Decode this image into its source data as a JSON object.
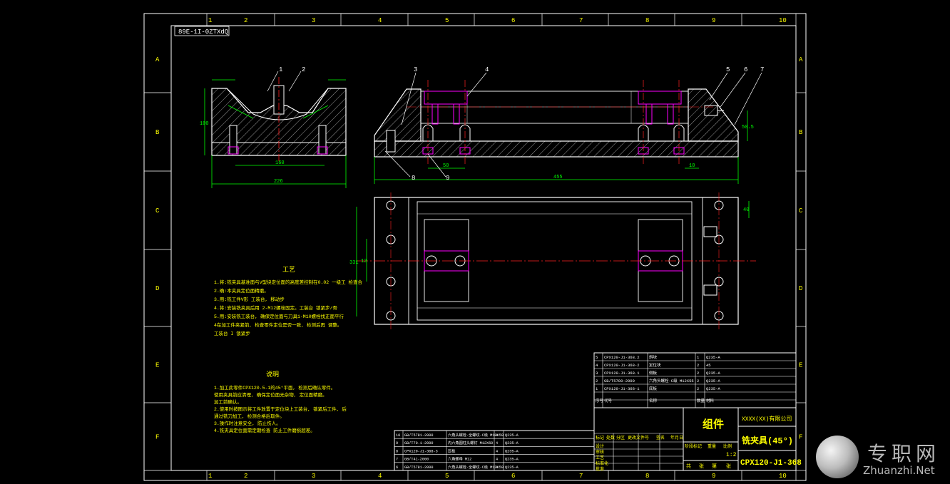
{
  "drawing": {
    "stamp_topleft": "89E-1I-0ZTXdQ",
    "drawing_no": "CPX120-J1-368",
    "title_main": "铣夹具(45°)",
    "title_assembly": "组件",
    "scale": "1:2",
    "company": "XXXX(XX)有限公司"
  },
  "grid": {
    "cols": [
      "1",
      "2",
      "3",
      "4",
      "5",
      "6",
      "7",
      "8",
      "9",
      "10"
    ],
    "rows": [
      "A",
      "B",
      "C",
      "D",
      "E",
      "F"
    ]
  },
  "dims": {
    "front_width": "226",
    "front_inner": "160",
    "front_height": "100",
    "side_length": "455",
    "side_a": "50",
    "side_b": "10",
    "side_h": "50.5",
    "plan_w": "331",
    "plan_a": "12",
    "plan_b": "40"
  },
  "callouts": [
    "1",
    "2",
    "3",
    "4",
    "5",
    "6",
    "7",
    "8",
    "9"
  ],
  "notes": {
    "title1": "工艺",
    "lines1": [
      "1.将:铣夹具基准面与V型块定位面的高度差控制在0.02 一级工 检查合",
      "2.确:本夹具定位面精磨。",
      "3.用:铣工件V形 工装台, 移动步",
      "4.将:安装铣夹具后用 2-M12螺栓固定。工装台 锁紧步/骨",
      "5.用:安装铣工装台, 确保定位面与刀具1-M10螺栓找正面平行",
      "4在加工件夹紧前, 检查零件定位是否一致, 检测后再 调整。",
      "工装台 I 锁紧步"
    ],
    "title2": "说明",
    "lines2": [
      "1.加工此零件CPX120.5-1的45°平面, 检测后确认零件。",
      "使用夹具前应清理, 确保定位面无杂物, 定位面精磨。",
      "加工前确认。",
      "2.使用时按图示将工件放置于定位块上工装台, 锁紧后工件, 后",
      "通过铣刀加工, 检测合格后取件。",
      "3.操作时注意安全, 防止伤人。",
      "4.铣夹具定位面需定期检查 防止工件磨损超差。"
    ]
  },
  "bom_upper": {
    "rows": [
      [
        "5",
        "CPX120-J1-368.2",
        "斜块",
        "1",
        "Q235-A"
      ],
      [
        "4",
        "CPX120-J1-368-2",
        "定位块",
        "2",
        "45"
      ],
      [
        "3",
        "CPX120-J1-368.1",
        "侧板",
        "2",
        "Q235-A"
      ],
      [
        "2",
        "GB/T5780-2000",
        "六角头螺栓-C级 M12X55",
        "2",
        "Q235-A"
      ],
      [
        "1",
        "CPX120-J1-368-1",
        "底板",
        "2",
        "Q235-A"
      ]
    ],
    "header": [
      "序号",
      "代号",
      "名称",
      "数量",
      "材料"
    ]
  },
  "bom_lower": {
    "rows": [
      [
        "10",
        "GB/T5781-2000",
        "六角头螺栓-全螺纹-C级 M10X50",
        "4",
        "Q235-A"
      ],
      [
        "9",
        "GB/T70.1-2000",
        "内六角圆柱头螺钉 M12X60",
        "4",
        "Q235-A"
      ],
      [
        "8",
        "CPX120-J1-368-3",
        "压板",
        "4",
        "Q235-A"
      ],
      [
        "7",
        "GB/T41-2000",
        "六角螺母 M12",
        "4",
        "Q235-A"
      ],
      [
        "6",
        "GB/T5781-2000",
        "六角头螺栓-全螺纹-C级 M12X50",
        "4",
        "Q235-A"
      ]
    ]
  },
  "titleblock": {
    "labels": [
      "标记",
      "处数",
      "分区",
      "更改文件号",
      "签名",
      "年月日"
    ],
    "roles": [
      "设计",
      "审核",
      "工艺",
      "标准化",
      "批准"
    ],
    "stage": [
      "阶段标记",
      "重量",
      "比例"
    ],
    "sheet": [
      "共",
      "张",
      "第",
      "张"
    ]
  },
  "watermark": {
    "cn": "专职网",
    "en": "Zhuanzhi.Net"
  },
  "colors": {
    "frame": "#ffffff",
    "part": "#ffffff",
    "hatch": "#ffffff",
    "dim": "#00ff00",
    "center": "#ff2020",
    "bolt": "#ff00ff",
    "text": "#ffff00"
  }
}
